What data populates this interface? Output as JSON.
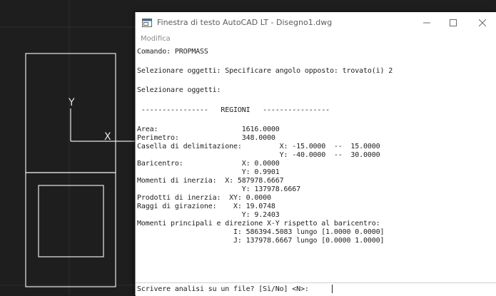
{
  "cad": {
    "ucs_y_label": "Y",
    "ucs_x_label": "X"
  },
  "window": {
    "title": "Finestra di testo AutoCAD LT - Disegno1.dwg",
    "minimize_icon": "minimize-icon",
    "maximize_icon": "maximize-icon",
    "close_icon": "close-icon",
    "menu": [
      "Modifica"
    ]
  },
  "console_lines": [
    "Comando: PROPMASS",
    "",
    "Selezionare oggetti: Specificare angolo opposto: trovato(i) 2",
    "",
    "Selezionare oggetti:",
    "",
    " ----------------   REGIONI   ----------------",
    "",
    "Area:                    1616.0000",
    "Perimetro:               348.0000",
    "Casella di delimitazione:         X: -15.0000  --  15.0000",
    "                                  Y: -40.0000  --  30.0000",
    "Baricentro:              X: 0.0000",
    "                         Y: 0.9901",
    "Momenti di inerzia:  X: 587978.6667",
    "                         Y: 137978.6667",
    "Prodotti di inerzia:  XY: 0.0000",
    "Raggi di girazione:    X: 19.0748",
    "                         Y: 9.2403",
    "Momenti principali e direzione X-Y rispetto al baricentro:",
    "                       I: 586394.5083 lungo [1.0000 0.0000]",
    "                       J: 137978.6667 lungo [0.0000 1.0000]"
  ],
  "prompt": "Scrivere analisi su un file? [Sì/No] <N>:",
  "colors": {
    "cad_background": "#1e1e1e",
    "cad_lines": "#e8e8e8",
    "window_background": "#ffffff",
    "text": "#222222"
  }
}
